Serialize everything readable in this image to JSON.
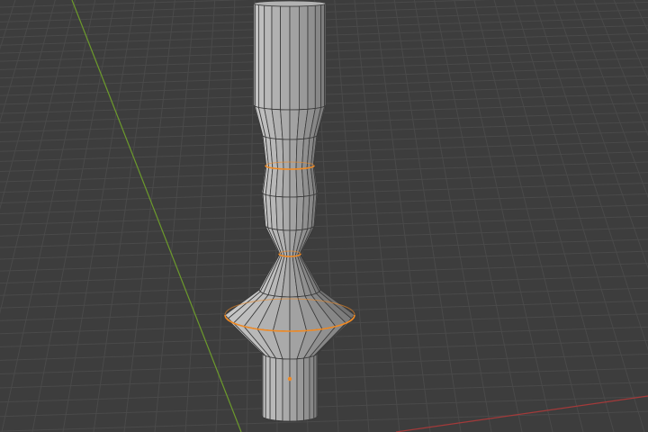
{
  "viewport": {
    "background": "#3d3d3d",
    "grid_color": "#4a4a4a",
    "x_axis_color": "#a33a3a",
    "y_axis_color": "#6c9a2c"
  },
  "mesh": {
    "object_type": "lathe-profile-mesh",
    "face_color_light": "#c8c8c8",
    "face_color_mid": "#a6a6a6",
    "face_color_dark": "#7c7c7c",
    "edge_color": "#3a3a3a",
    "selected_edge_color": "#f08a24",
    "origin_color": "#f08a24",
    "segments_visible": 12,
    "selected_edge_loops": 3
  }
}
